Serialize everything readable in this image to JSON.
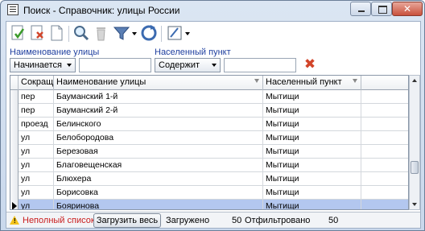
{
  "window": {
    "title": "Поиск - Справочник: улицы России",
    "close_glyph": "✕"
  },
  "toolbar": {
    "icons": [
      "accept-icon",
      "cancel-icon",
      "new-document-icon",
      "search-icon",
      "delete-icon",
      "filter-icon",
      "refresh-icon",
      "edit-icon"
    ]
  },
  "filters": {
    "street_label": "Наименование улицы",
    "street_mode": "Начинается",
    "street_value": "",
    "city_label": "Населенный пункт",
    "city_mode": "Содержит",
    "city_value": "",
    "clear_glyph": "✖"
  },
  "grid": {
    "columns": [
      "Сокращен",
      "Наименование улицы",
      "Населенный пункт"
    ],
    "rows": [
      {
        "abbr": "пер",
        "street": "Бауманский 1-й",
        "city": "Мытищи"
      },
      {
        "abbr": "пер",
        "street": "Бауманский 2-й",
        "city": "Мытищи"
      },
      {
        "abbr": "проезд",
        "street": "Белинского",
        "city": "Мытищи"
      },
      {
        "abbr": "ул",
        "street": "Белобородова",
        "city": "Мытищи"
      },
      {
        "abbr": "ул",
        "street": "Березовая",
        "city": "Мытищи"
      },
      {
        "abbr": "ул",
        "street": "Благовещенская",
        "city": "Мытищи"
      },
      {
        "abbr": "ул",
        "street": "Блюхера",
        "city": "Мытищи"
      },
      {
        "abbr": "ул",
        "street": "Борисовка",
        "city": "Мытищи"
      },
      {
        "abbr": "ул",
        "street": "Бояринова",
        "city": "Мытищи"
      }
    ],
    "selected_index": 8
  },
  "status": {
    "warn_glyph": "!",
    "incomplete": "Неполный список",
    "load_all": "Загрузить весь",
    "loaded_label": "Загружено",
    "loaded_count": "50",
    "filtered_label": "Отфильтровано",
    "filtered_count": "50"
  }
}
